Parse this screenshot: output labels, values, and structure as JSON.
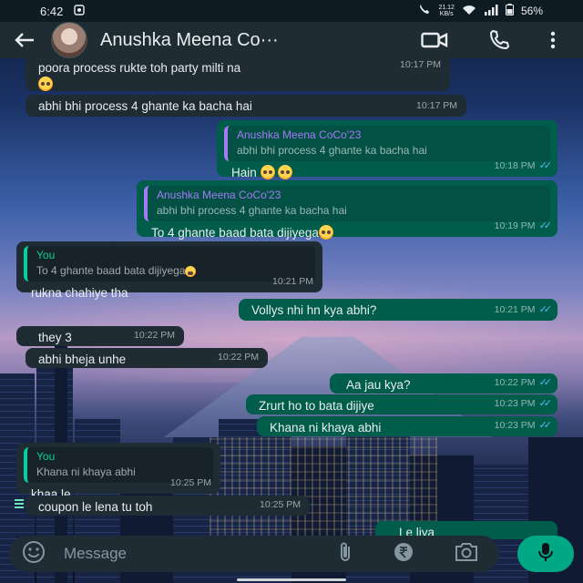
{
  "status_bar": {
    "time": "6:42",
    "net_speed": "21.12",
    "net_unit": "KB/s",
    "battery": "56%"
  },
  "header": {
    "contact_name": "Anushka Meena Co···"
  },
  "messages": [
    {
      "text": "poora process rukte toh party milti na",
      "time": "10:17 PM"
    },
    {
      "text": "abhi bhi process 4 ghante ka bacha hai",
      "time": "10:17 PM"
    },
    {
      "quote_name": "Anushka Meena CoCo'23",
      "quote_text": "abhi bhi process 4 ghante ka bacha hai",
      "text": "Hain",
      "time": "10:18 PM"
    },
    {
      "quote_name": "Anushka Meena CoCo'23",
      "quote_text": "abhi bhi process 4 ghante ka bacha hai",
      "text": "To 4 ghante baad bata dijiyega",
      "time": "10:19 PM"
    },
    {
      "quote_name": "You",
      "quote_text": "To 4 ghante baad bata dijiyega",
      "text": "rukna chahiye tha",
      "time": "10:21 PM"
    },
    {
      "text": "Vollys nhi hn kya abhi?",
      "time": "10:21 PM"
    },
    {
      "text": "they 3",
      "time": "10:22 PM"
    },
    {
      "text": "abhi bheja unhe",
      "time": "10:22 PM"
    },
    {
      "text": "Aa jau kya?",
      "time": "10:22 PM"
    },
    {
      "text": "Zrurt ho to bata dijiye",
      "time": "10:23 PM"
    },
    {
      "text": "Khana ni khaya abhi",
      "time": "10:23 PM"
    },
    {
      "quote_name": "You",
      "quote_text": "Khana ni khaya abhi",
      "text": "khaa le",
      "time": "10:25 PM"
    },
    {
      "text": "coupon le lena tu toh",
      "time": "10:25 PM"
    },
    {
      "text": "Le liya"
    }
  ],
  "input": {
    "placeholder": "Message"
  }
}
